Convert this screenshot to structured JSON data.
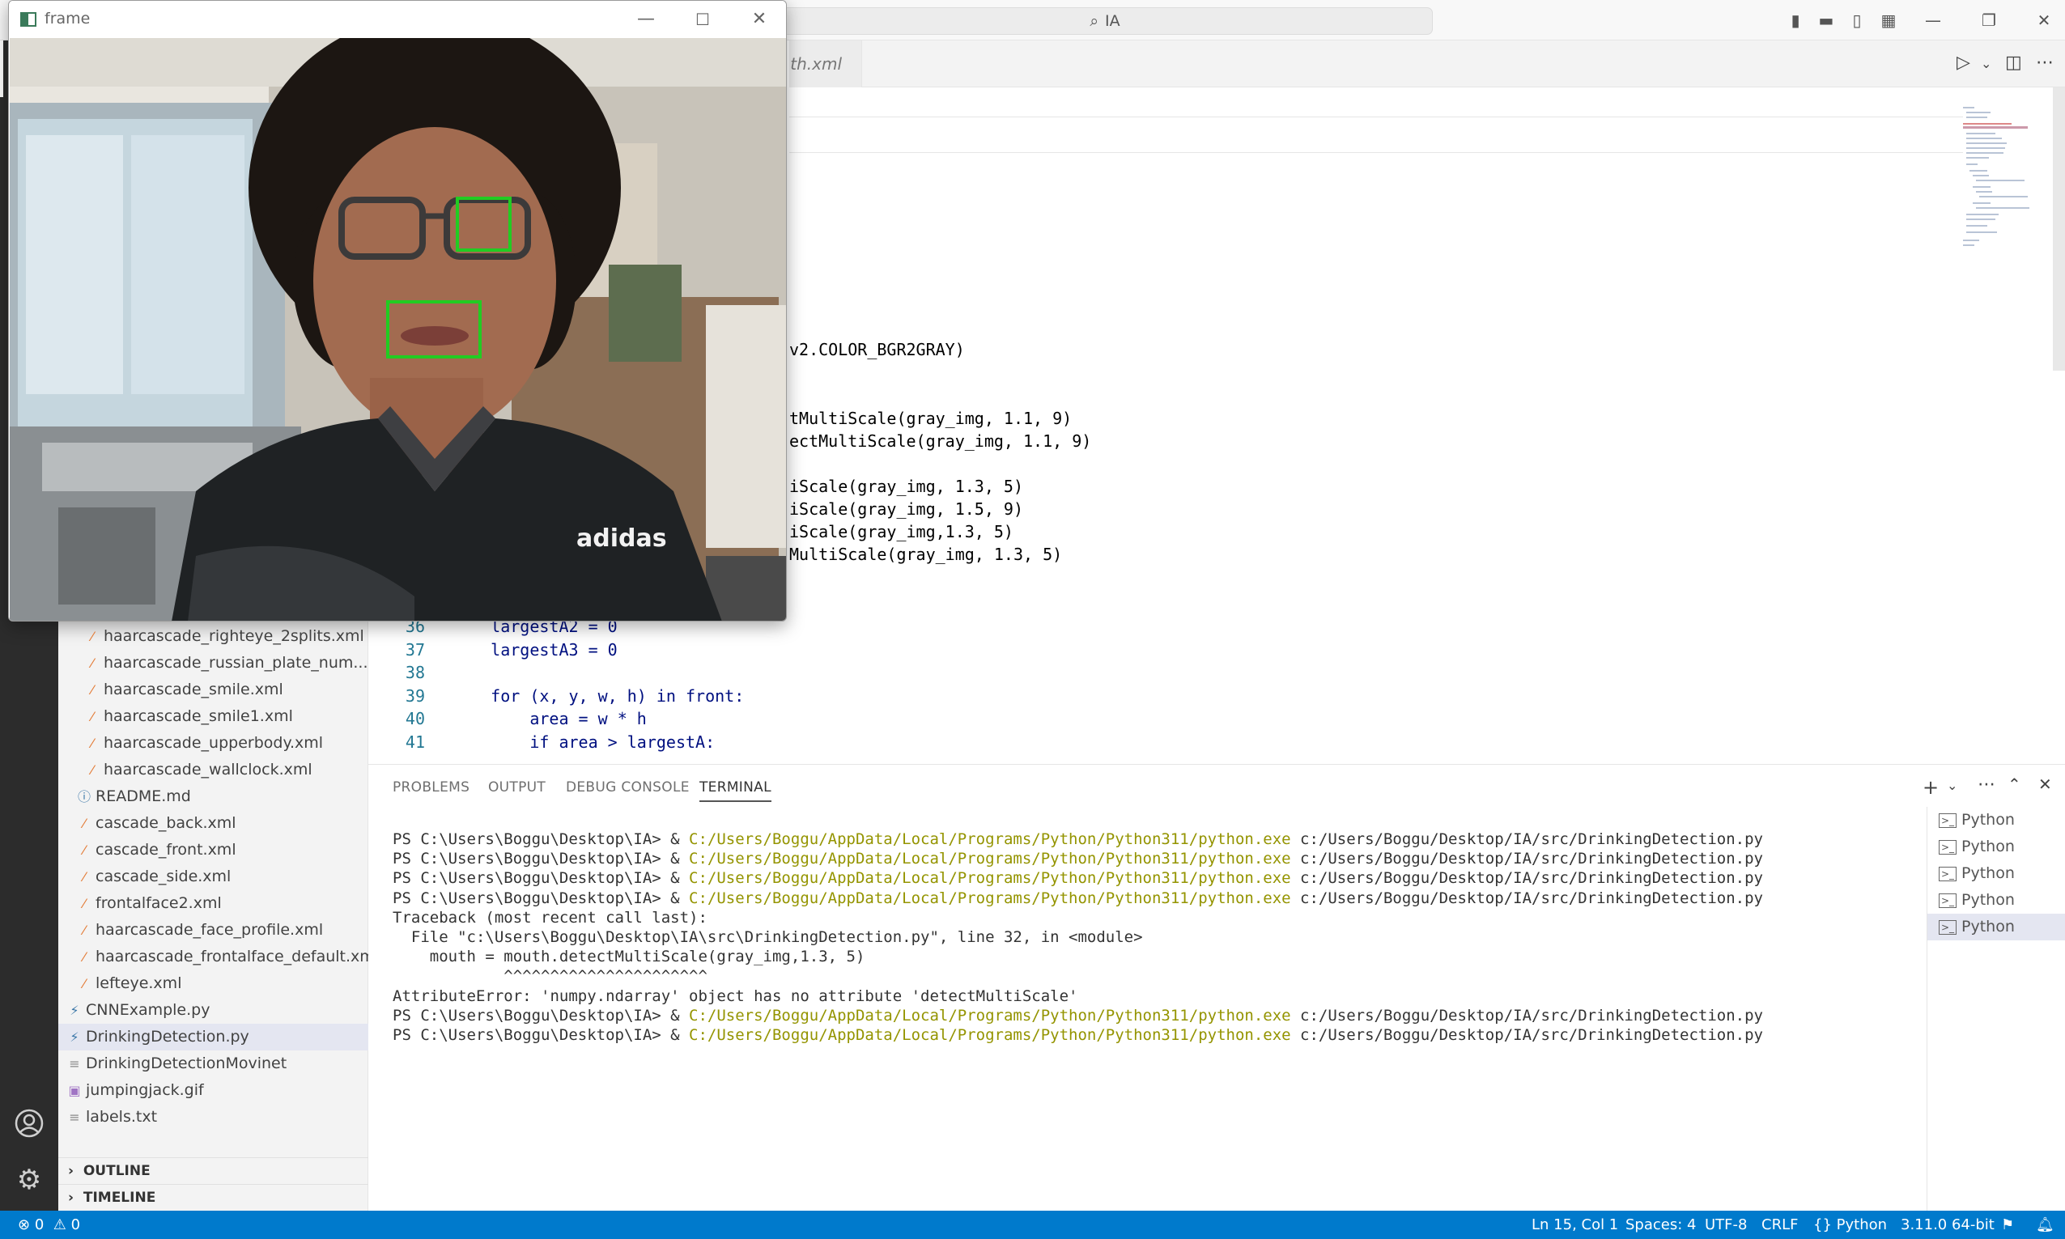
{
  "titlebar": {
    "search_text": "IA"
  },
  "editor": {
    "partial_tab": "th.xml",
    "lines": [
      {
        "text": "v2.COLOR_BGR2GRAY)"
      },
      {
        "text": "tMultiScale(gray_img, 1.1, 9)"
      },
      {
        "text": "ectMultiScale(gray_img, 1.1, 9)"
      },
      {
        "text": "iScale(gray_img, 1.3, 5)"
      },
      {
        "text": "iScale(gray_img, 1.5, 9)"
      },
      {
        "text": "iScale(gray_img,1.3, 5)"
      },
      {
        "text": "MultiScale(gray_img, 1.3, 5)"
      }
    ],
    "numbered_lines": [
      {
        "num": "36",
        "text": "    largestA2 = 0"
      },
      {
        "num": "37",
        "text": "    largestA3 = 0"
      },
      {
        "num": "38",
        "text": ""
      },
      {
        "num": "39",
        "text": "    for (x, y, w, h) in front:"
      },
      {
        "num": "40",
        "text": "        area = w * h"
      },
      {
        "num": "41",
        "text": "        if area > largestA:"
      }
    ]
  },
  "sidebar": {
    "files": [
      {
        "name": "haarcascade_righteye_2splits.xml",
        "type": "xml"
      },
      {
        "name": "haarcascade_russian_plate_num...",
        "type": "xml"
      },
      {
        "name": "haarcascade_smile.xml",
        "type": "xml"
      },
      {
        "name": "haarcascade_smile1.xml",
        "type": "xml"
      },
      {
        "name": "haarcascade_upperbody.xml",
        "type": "xml"
      },
      {
        "name": "haarcascade_wallclock.xml",
        "type": "xml"
      },
      {
        "name": "README.md",
        "type": "info"
      },
      {
        "name": "cascade_back.xml",
        "type": "xml"
      },
      {
        "name": "cascade_front.xml",
        "type": "xml"
      },
      {
        "name": "cascade_side.xml",
        "type": "xml"
      },
      {
        "name": "frontalface2.xml",
        "type": "xml"
      },
      {
        "name": "haarcascade_face_profile.xml",
        "type": "xml"
      },
      {
        "name": "haarcascade_frontalface_default.xml",
        "type": "xml"
      },
      {
        "name": "lefteye.xml",
        "type": "xml"
      },
      {
        "name": "CNNExample.py",
        "type": "py"
      },
      {
        "name": "DrinkingDetection.py",
        "type": "py"
      },
      {
        "name": "DrinkingDetectionMovinet",
        "type": "txt"
      },
      {
        "name": "jumpingjack.gif",
        "type": "gif"
      },
      {
        "name": "labels.txt",
        "type": "txt"
      }
    ],
    "outline_label": "OUTLINE",
    "timeline_label": "TIMELINE"
  },
  "panel": {
    "tabs": [
      "PROBLEMS",
      "OUTPUT",
      "DEBUG CONSOLE",
      "TERMINAL"
    ],
    "active_tab": "TERMINAL",
    "terminal": [
      {
        "prompt": "PS C:\\Users\\Boggu\\Desktop\\IA> & ",
        "exe": "C:/Users/Boggu/AppData/Local/Programs/Python/Python311/python.exe",
        "arg": " c:/Users/Boggu/Desktop/IA/src/DrinkingDetection.py"
      },
      {
        "prompt": "PS C:\\Users\\Boggu\\Desktop\\IA> & ",
        "exe": "C:/Users/Boggu/AppData/Local/Programs/Python/Python311/python.exe",
        "arg": " c:/Users/Boggu/Desktop/IA/src/DrinkingDetection.py"
      },
      {
        "prompt": "PS C:\\Users\\Boggu\\Desktop\\IA> & ",
        "exe": "C:/Users/Boggu/AppData/Local/Programs/Python/Python311/python.exe",
        "arg": " c:/Users/Boggu/Desktop/IA/src/DrinkingDetection.py"
      },
      {
        "prompt": "PS C:\\Users\\Boggu\\Desktop\\IA> & ",
        "exe": "C:/Users/Boggu/AppData/Local/Programs/Python/Python311/python.exe",
        "arg": " c:/Users/Boggu/Desktop/IA/src/DrinkingDetection.py"
      },
      {
        "prompt": "Traceback (most recent call last):",
        "exe": "",
        "arg": ""
      },
      {
        "prompt": "  File \"c:\\Users\\Boggu\\Desktop\\IA\\src\\DrinkingDetection.py\", line 32, in <module>",
        "exe": "",
        "arg": ""
      },
      {
        "prompt": "    mouth = mouth.detectMultiScale(gray_img,1.3, 5)",
        "exe": "",
        "arg": ""
      },
      {
        "prompt": "            ^^^^^^^^^^^^^^^^^^^^^^",
        "exe": "",
        "arg": ""
      },
      {
        "prompt": "AttributeError: 'numpy.ndarray' object has no attribute 'detectMultiScale'",
        "exe": "",
        "arg": ""
      },
      {
        "prompt": "PS C:\\Users\\Boggu\\Desktop\\IA> & ",
        "exe": "C:/Users/Boggu/AppData/Local/Programs/Python/Python311/python.exe",
        "arg": " c:/Users/Boggu/Desktop/IA/src/DrinkingDetection.py"
      },
      {
        "prompt": "PS C:\\Users\\Boggu\\Desktop\\IA> & ",
        "exe": "C:/Users/Boggu/AppData/Local/Programs/Python/Python311/python.exe",
        "arg": " c:/Users/Boggu/Desktop/IA/src/DrinkingDetection.py"
      }
    ],
    "terminal_list": [
      "Python",
      "Python",
      "Python",
      "Python",
      "Python"
    ]
  },
  "statusbar": {
    "errors": "0",
    "warnings": "0",
    "position": "Ln 15, Col 1",
    "spaces": "Spaces: 4",
    "encoding": "UTF-8",
    "eol": "CRLF",
    "language": "Python",
    "interpreter": "3.11.0 64-bit"
  },
  "frame_window": {
    "title": "frame"
  },
  "colors": {
    "statusbar": "#007acc",
    "activitybar": "#2c2c2c",
    "detection_box": "#22cc22"
  }
}
